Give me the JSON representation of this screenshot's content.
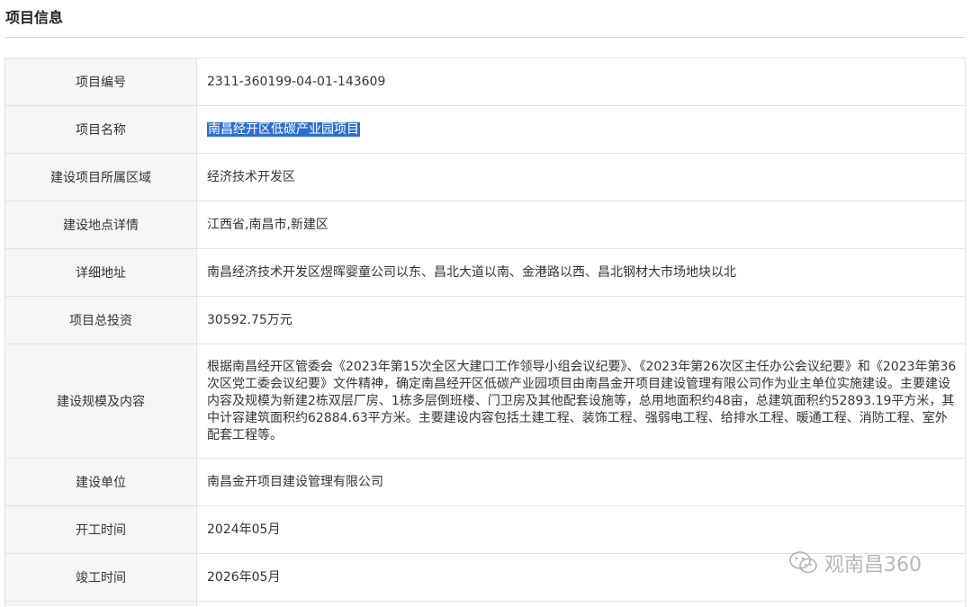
{
  "section": {
    "title": "项目信息"
  },
  "rows": [
    {
      "label": "项目编号",
      "value": "2311-360199-04-01-143609"
    },
    {
      "label": "项目名称",
      "value": "南昌经开区低碳产业园项目"
    },
    {
      "label": "建设项目所属区域",
      "value": "经济技术开发区"
    },
    {
      "label": "建设地点详情",
      "value": "江西省,南昌市,新建区"
    },
    {
      "label": "详细地址",
      "value": "南昌经济技术开发区煜晖婴童公司以东、昌北大道以南、金港路以西、昌北钢材大市场地块以北"
    },
    {
      "label": "项目总投资",
      "value": "30592.75万元"
    },
    {
      "label": "建设规模及内容",
      "value": "根据南昌经开区管委会《2023年第15次全区大建口工作领导小组会议纪要》、《2023年第26次区主任办公会议纪要》和《2023年第36次区党工委会议纪要》文件精神，确定南昌经开区低碳产业园项目由南昌金开项目建设管理有限公司作为业主单位实施建设。主要建设内容及规模为新建2栋双层厂房、1栋多层倒班楼、门卫房及其他配套设施等，总用地面积约48亩，总建筑面积约52893.19平方米，其中计容建筑面积约62884.63平方米。主要建设内容包括土建工程、装饰工程、强弱电工程、给排水工程、暖通工程、消防工程、室外配套工程等。"
    },
    {
      "label": "建设单位",
      "value": "南昌金开项目建设管理有限公司"
    },
    {
      "label": "开工时间",
      "value": "2024年05月"
    },
    {
      "label": "竣工时间",
      "value": "2026年05月"
    }
  ],
  "watermark": {
    "text": "观南昌360",
    "icon": "wechat-icon"
  }
}
